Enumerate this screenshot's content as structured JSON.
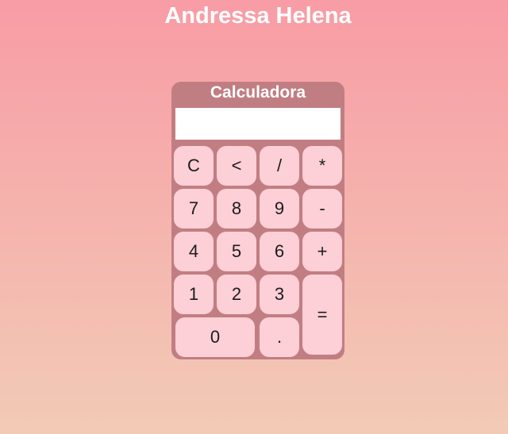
{
  "page": {
    "title": "Andressa Helena"
  },
  "calculator": {
    "title": "Calculadora",
    "display_value": "",
    "keys": {
      "clear": "C",
      "backspace": "<",
      "divide": "/",
      "multiply": "*",
      "seven": "7",
      "eight": "8",
      "nine": "9",
      "minus": "-",
      "four": "4",
      "five": "5",
      "six": "6",
      "plus": "+",
      "one": "1",
      "two": "2",
      "three": "3",
      "equals": "=",
      "zero": "0",
      "decimal": "."
    }
  },
  "colors": {
    "background_top": "#f89ca5",
    "background_bottom": "#f2cbb6",
    "calculator_body": "#c17e82",
    "key_face": "#fdcfd7",
    "display": "#ffffff"
  }
}
